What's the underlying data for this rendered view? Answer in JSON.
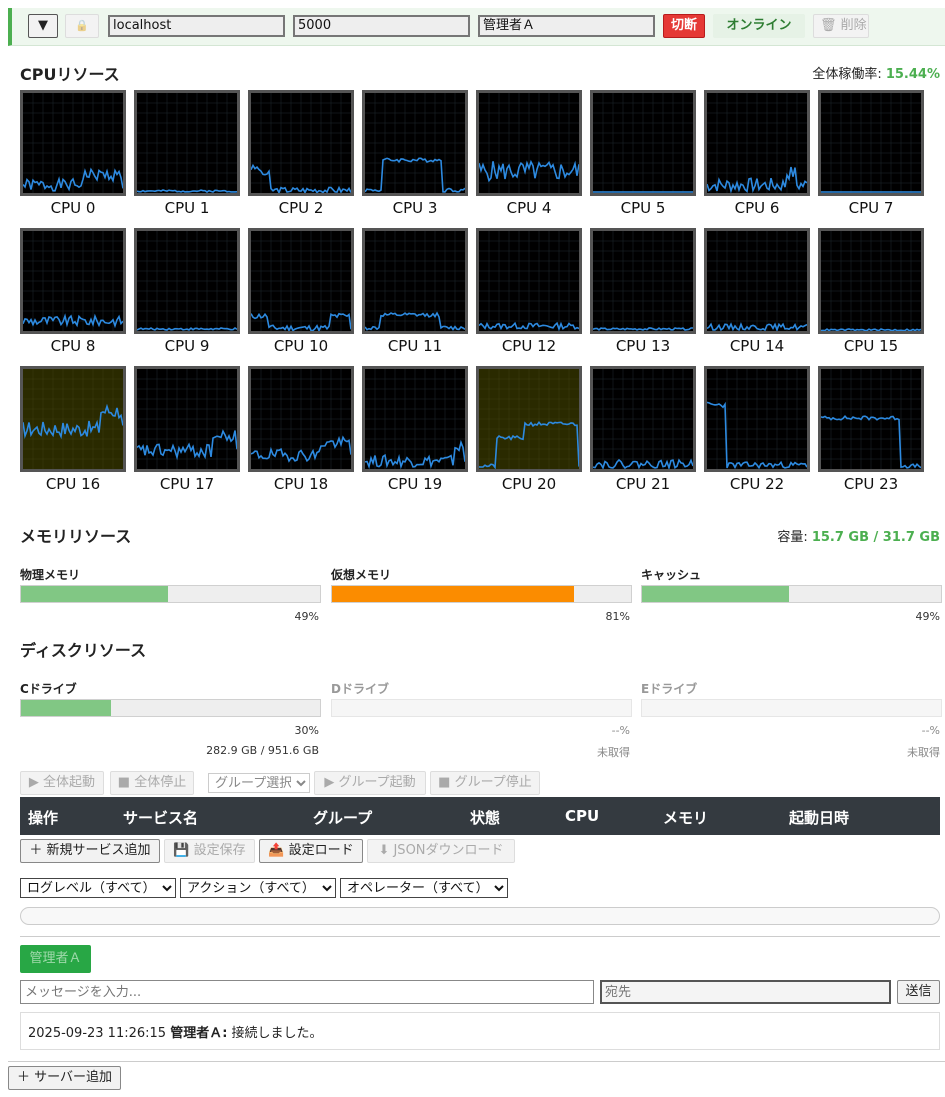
{
  "server": {
    "toggle": "▼",
    "lock": "🔒",
    "host": "localhost",
    "port": "5000",
    "user": "管理者Ａ",
    "disconnect": "切断",
    "status": "オンライン",
    "delete": "🗑 削除"
  },
  "cpu": {
    "title": "CPUリソース",
    "overall_label": "全体稼働率: ",
    "overall_value": "15.44%",
    "labels": [
      "CPU 0",
      "CPU 1",
      "CPU 2",
      "CPU 3",
      "CPU 4",
      "CPU 5",
      "CPU 6",
      "CPU 7",
      "CPU 8",
      "CPU 9",
      "CPU 10",
      "CPU 11",
      "CPU 12",
      "CPU 13",
      "CPU 14",
      "CPU 15",
      "CPU 16",
      "CPU 17",
      "CPU 18",
      "CPU 19",
      "CPU 20",
      "CPU 21",
      "CPU 22",
      "CPU 23"
    ],
    "line_color": "#2d8ae0",
    "hot_bg": "#2a2a00"
  },
  "memory": {
    "title": "メモリリソース",
    "capacity_label": "容量: ",
    "capacity_value": "15.7 GB / 31.7 GB",
    "items": [
      {
        "label": "物理メモリ",
        "percent": 49,
        "value": "49%",
        "color": "#81c784"
      },
      {
        "label": "仮想メモリ",
        "percent": 81,
        "value": "81%",
        "color": "#fb8c00"
      },
      {
        "label": "キャッシュ",
        "percent": 49,
        "value": "49%",
        "color": "#81c784"
      }
    ]
  },
  "disk": {
    "title": "ディスクリソース",
    "items": [
      {
        "label": "Cドライブ",
        "percent": 30,
        "value": "30%",
        "detail": "282.9 GB / 951.6 GB",
        "color": "#81c784"
      },
      {
        "label": "Dドライブ",
        "percent": 0,
        "value": "--%",
        "detail": "未取得",
        "color": "#81c784"
      },
      {
        "label": "Eドライブ",
        "percent": 0,
        "value": "--%",
        "detail": "未取得",
        "color": "#81c784"
      }
    ]
  },
  "group_controls": {
    "start_all": "▶ 全体起動",
    "stop_all": "■ 全体停止",
    "group_select": "グループ選択",
    "group_start": "▶ グループ起動",
    "group_stop": "■ グループ停止"
  },
  "services_table": {
    "columns": [
      "操作",
      "サービス名",
      "グループ",
      "状態",
      "CPU",
      "メモリ",
      "起動日時"
    ]
  },
  "service_actions": {
    "add": "＋ 新規サービス追加",
    "save": "💾 設定保存",
    "load": "📤 設定ロード",
    "json": "⬇ JSONダウンロード"
  },
  "log_filters": {
    "level": "ログレベル（すべて）",
    "action": "アクション（すべて）",
    "operator": "オペレーター（すべて）"
  },
  "chat": {
    "tab": "管理者Ａ",
    "message_placeholder": "メッセージを入力...",
    "to_placeholder": "宛先",
    "send": "送信",
    "log": [
      {
        "time": "2025-09-23 11:26:15",
        "user": "管理者Ａ:",
        "text": " 接続しました。"
      }
    ]
  },
  "add_server": "＋ サーバー追加"
}
